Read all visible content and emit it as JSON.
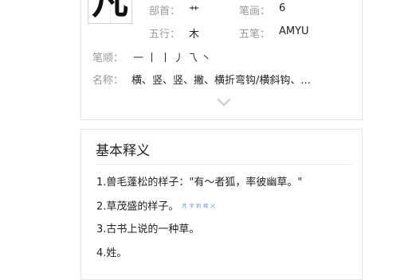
{
  "character": "凡",
  "info": {
    "radical_label": "部首：",
    "radical_value": "艹",
    "strokes_count_label": "笔画：",
    "strokes_count_value": "6",
    "wuxing_label": "五行：",
    "wuxing_value": "木",
    "wubi_label": "五笔：",
    "wubi_value": "AMYU",
    "order_label": "笔顺：",
    "order_strokes": [
      "一",
      "丨",
      "丨",
      "丿",
      "乁",
      "丶"
    ],
    "names_label": "名称：",
    "names_value": "横、竖、竖、撇、横折弯钩/横斜钩、..."
  },
  "expand_icon": "chevron-down-icon",
  "definitions": {
    "title": "基本释义",
    "items": [
      "1.兽毛蓬松的样子：\"有～者狐，率彼幽草。\"",
      "2.草茂盛的样子。",
      "3.古书上说的一种草。",
      "4.姓。"
    ],
    "watermark": "芃 字 的 释 义"
  },
  "colors": {
    "label": "#999999",
    "text": "#222222",
    "border": "#e6e6e6",
    "watermark": "#4a8ad8"
  }
}
